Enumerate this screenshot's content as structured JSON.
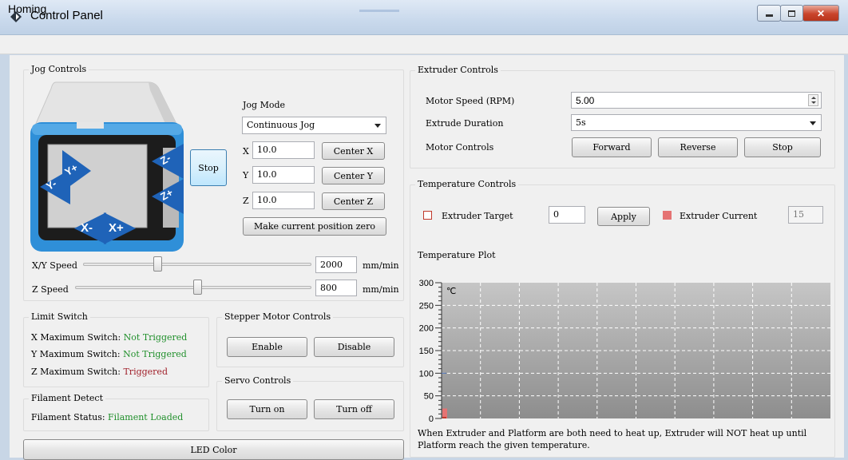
{
  "window": {
    "title": "Control Panel",
    "menu_homing": "Homing"
  },
  "jog": {
    "group_title": "Jog Controls",
    "mode_label": "Jog Mode",
    "mode_value": "Continuous Jog",
    "stop_label": "Stop",
    "x_label": "X",
    "x_value": "10.0",
    "center_x": "Center X",
    "y_label": "Y",
    "y_value": "10.0",
    "center_y": "Center Y",
    "z_label": "Z",
    "z_value": "10.0",
    "center_z": "Center Z",
    "make_zero": "Make current position zero",
    "buttons": {
      "y_minus": "Y-",
      "y_plus": "Y+",
      "z_minus": "Z-",
      "z_plus": "Z+",
      "x_minus": "X-",
      "x_plus": "X+"
    },
    "xy_speed_label": "X/Y Speed",
    "xy_speed_value": "2000",
    "xy_speed_unit": "mm/min",
    "xy_speed_fraction": 0.33,
    "z_speed_label": "Z Speed",
    "z_speed_value": "800",
    "z_speed_unit": "mm/min",
    "z_speed_fraction": 0.52
  },
  "limits": {
    "group_title": "Limit Switch",
    "x_label": "X Maximum Switch:",
    "x_status": "Not Triggered",
    "y_label": "Y Maximum Switch:",
    "y_status": "Not Triggered",
    "z_label": "Z Maximum Switch:",
    "z_status": "Triggered",
    "status_colors": {
      "not_triggered": "#1f8f2a",
      "triggered": "#a0202a"
    }
  },
  "filament": {
    "group_title": "Filament Detect",
    "label": "Filament Status:",
    "status": "Filament Loaded"
  },
  "stepper": {
    "group_title": "Stepper Motor Controls",
    "enable": "Enable",
    "disable": "Disable"
  },
  "servo": {
    "group_title": "Servo Controls",
    "turn_on": "Turn on",
    "turn_off": "Turn off"
  },
  "led": {
    "label": "LED Color"
  },
  "extruder": {
    "group_title": "Extruder Controls",
    "speed_label": "Motor Speed (RPM)",
    "speed_value": "5.00",
    "duration_label": "Extrude Duration",
    "duration_value": "5s",
    "motor_label": "Motor Controls",
    "forward": "Forward",
    "reverse": "Reverse",
    "stop": "Stop"
  },
  "temperature": {
    "group_title": "Temperature Controls",
    "target_label": "Extruder Target",
    "target_value": "0",
    "apply": "Apply",
    "current_label": "Extruder Current",
    "current_value": "15",
    "plot_label": "Temperature Plot",
    "unit": "℃",
    "y_ticks": [
      "300",
      "250",
      "200",
      "150",
      "100",
      "50",
      "0"
    ],
    "note": "When Extruder and Platform are both need to heat up, Extruder will NOT heat up until Platform reach the given temperature.",
    "colors": {
      "target": "#c0392b",
      "current": "#e57373"
    }
  },
  "chart_data": {
    "type": "line",
    "title": "",
    "ylabel": "℃",
    "ylim": [
      0,
      300
    ],
    "yticks": [
      0,
      50,
      100,
      150,
      200,
      250,
      300
    ],
    "grid": true,
    "series": [
      {
        "name": "Extruder Target",
        "values": [
          0
        ]
      },
      {
        "name": "Extruder Current",
        "values": [
          15
        ]
      }
    ]
  }
}
